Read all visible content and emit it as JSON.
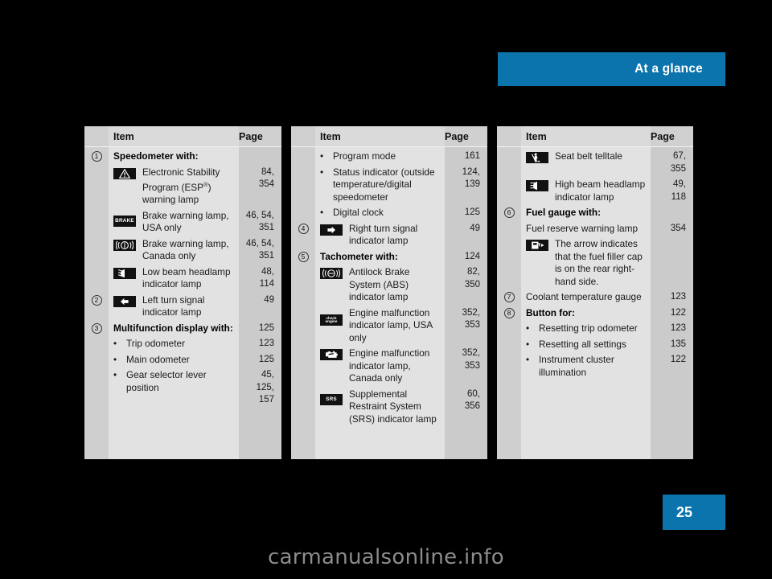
{
  "header": {
    "title": "At a glance"
  },
  "page_badge": {
    "number": "25"
  },
  "watermark": {
    "text": "carmanualsonline.info"
  },
  "table": {
    "headers": {
      "item": "Item",
      "page": "Page"
    },
    "columns": [
      {
        "rows": [
          {
            "num": "1",
            "kind": "bold",
            "text": "Speedometer with:",
            "page": ""
          },
          {
            "num": "",
            "kind": "icon",
            "icon": "esp-warning-lamp-icon",
            "text": "Electronic Stability Program (ESP®) warning lamp",
            "page": "84,\n354"
          },
          {
            "num": "",
            "kind": "icon",
            "icon": "brake-warning-lamp-usa-icon",
            "text": "Brake warning lamp, USA only",
            "page": "46, 54,\n351"
          },
          {
            "num": "",
            "kind": "icon",
            "icon": "brake-warning-lamp-canada-icon",
            "text": "Brake warning lamp, Canada only",
            "page": "46, 54,\n351"
          },
          {
            "num": "",
            "kind": "icon",
            "icon": "low-beam-headlamp-icon",
            "text": "Low beam headlamp indicator lamp",
            "page": "48,\n114"
          },
          {
            "num": "2",
            "kind": "icon",
            "icon": "left-turn-signal-icon",
            "text": "Left turn signal indicator lamp",
            "page": "49"
          },
          {
            "num": "3",
            "kind": "bold",
            "text": "Multifunction display with:",
            "page": "125"
          },
          {
            "num": "",
            "kind": "bullet",
            "text": "Trip odometer",
            "page": "123"
          },
          {
            "num": "",
            "kind": "bullet",
            "text": "Main odometer",
            "page": "125"
          },
          {
            "num": "",
            "kind": "bullet",
            "text": "Gear selector lever position",
            "page": "45,\n125,\n157"
          }
        ]
      },
      {
        "rows": [
          {
            "num": "",
            "kind": "bullet",
            "text": "Program mode",
            "page": "161"
          },
          {
            "num": "",
            "kind": "bullet",
            "text": "Status indicator (outside temperature/digital speedometer",
            "page": "124,\n139"
          },
          {
            "num": "",
            "kind": "bullet",
            "text": "Digital clock",
            "page": "125"
          },
          {
            "num": "4",
            "kind": "icon",
            "icon": "right-turn-signal-icon",
            "text": "Right turn signal indicator lamp",
            "page": "49"
          },
          {
            "num": "5",
            "kind": "bold",
            "text": "Tachometer with:",
            "page": "124"
          },
          {
            "num": "",
            "kind": "icon",
            "icon": "abs-indicator-lamp-icon",
            "text": "Antilock Brake System (ABS) indicator lamp",
            "page": "82,\n350"
          },
          {
            "num": "",
            "kind": "icon",
            "icon": "check-engine-lamp-usa-icon",
            "text": "Engine malfunction indicator lamp, USA only",
            "page": "352,\n353"
          },
          {
            "num": "",
            "kind": "icon",
            "icon": "engine-malfunction-lamp-canada-icon",
            "text": "Engine malfunction indicator lamp, Canada only",
            "page": "352,\n353"
          },
          {
            "num": "",
            "kind": "icon",
            "icon": "srs-indicator-lamp-icon",
            "text": "Supplemental Restraint System (SRS) indicator lamp",
            "page": "60,\n356"
          }
        ]
      },
      {
        "rows": [
          {
            "num": "",
            "kind": "icon",
            "icon": "seat-belt-telltale-icon",
            "text": "Seat belt telltale",
            "page": "67,\n355"
          },
          {
            "num": "",
            "kind": "icon",
            "icon": "high-beam-headlamp-icon",
            "text": "High beam headlamp indicator lamp",
            "page": "49,\n118"
          },
          {
            "num": "6",
            "kind": "bold",
            "text": "Fuel gauge with:",
            "page": ""
          },
          {
            "num": "",
            "kind": "plain",
            "text": "Fuel reserve warning lamp",
            "page": "354"
          },
          {
            "num": "",
            "kind": "icon",
            "icon": "fuel-filler-cap-arrow-icon",
            "text": "The arrow indicates that the fuel filler cap is on the rear right-hand side.",
            "page": ""
          },
          {
            "num": "7",
            "kind": "plain",
            "text": "Coolant temperature gauge",
            "page": "123"
          },
          {
            "num": "8",
            "kind": "bold",
            "text": "Button for:",
            "page": "122"
          },
          {
            "num": "",
            "kind": "bullet",
            "text": "Resetting trip odometer",
            "page": "123"
          },
          {
            "num": "",
            "kind": "bullet",
            "text": "Resetting all settings",
            "page": "135"
          },
          {
            "num": "",
            "kind": "bullet",
            "text": "Instrument cluster illumination",
            "page": "122"
          }
        ]
      }
    ]
  },
  "colors": {
    "brand_blue": "#0b74ad",
    "page_bg": "#000000",
    "table_bg": "#e2e2e2",
    "gutter_bg": "#cfcfcf",
    "page_col_bg": "#cbcbcb",
    "icon_black": "#111111",
    "watermark_gray": "#8c8c8c"
  }
}
